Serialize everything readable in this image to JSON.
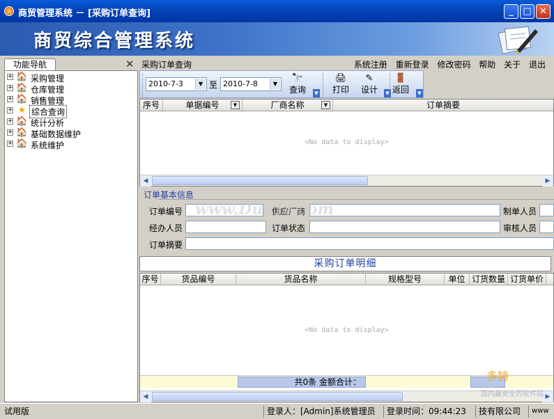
{
  "window": {
    "title": "商贸管理系统 － [采购订单查询]",
    "buttons": {
      "minimize": "_",
      "maximize": "□",
      "close": "✕"
    }
  },
  "banner": {
    "title": "商贸综合管理系统"
  },
  "nav": {
    "tab_label": "功能导航",
    "close_glyph": "✕",
    "items": [
      {
        "label": "采购管理",
        "icon": "house-icon"
      },
      {
        "label": "仓库管理",
        "icon": "house-icon"
      },
      {
        "label": "销售管理",
        "icon": "house-icon"
      },
      {
        "label": "综合查询",
        "icon": "star-icon",
        "selected": true
      },
      {
        "label": "统计分析",
        "icon": "house-icon"
      },
      {
        "label": "基础数据维护",
        "icon": "house-icon"
      },
      {
        "label": "系统维护",
        "icon": "house-icon"
      }
    ]
  },
  "menubar": {
    "crumb": "采购订单查询",
    "links": [
      "系统注册",
      "重新登录",
      "修改密码",
      "帮助",
      "关于",
      "退出"
    ]
  },
  "toolbar": {
    "date_from": "2010-7-3",
    "to_label": "至",
    "date_to": "2010-7-8",
    "query": "查询",
    "print": "打印",
    "design": "设计",
    "back": "返回"
  },
  "orders_grid": {
    "columns": [
      "序号",
      "单据编号",
      "厂商名称",
      "订单摘要"
    ],
    "empty_text": "<No data to display>"
  },
  "order_info": {
    "title": "订单基本信息",
    "labels": {
      "order_no": "订单编号",
      "supplier": "供应厂商",
      "creator": "制单人员",
      "handler": "经办人员",
      "status": "订单状态",
      "reviewer": "审核人员",
      "summary": "订单摘要"
    }
  },
  "detail": {
    "title": "采购订单明细",
    "columns": [
      "序号",
      "货品编号",
      "货品名称",
      "规格型号",
      "单位",
      "订货数量",
      "订货单价"
    ],
    "empty_text": "<No data to display>",
    "summary": "共0条  金额合计："
  },
  "statusbar": {
    "mode": "试用版",
    "user": "登录人：[Admin]系统管理员",
    "login_time": "登录时间：09:44:23",
    "company": "技有限公司",
    "extra": "www"
  },
  "watermarks": {
    "center": "www.DuoTe.com",
    "corner_main": "多特",
    "corner_sub": "国内最安全的软件站"
  },
  "colors": {
    "titlebar": "#0441b4",
    "accent_text": "#1f3fa0",
    "summary_bg": "#fdfbd6"
  }
}
